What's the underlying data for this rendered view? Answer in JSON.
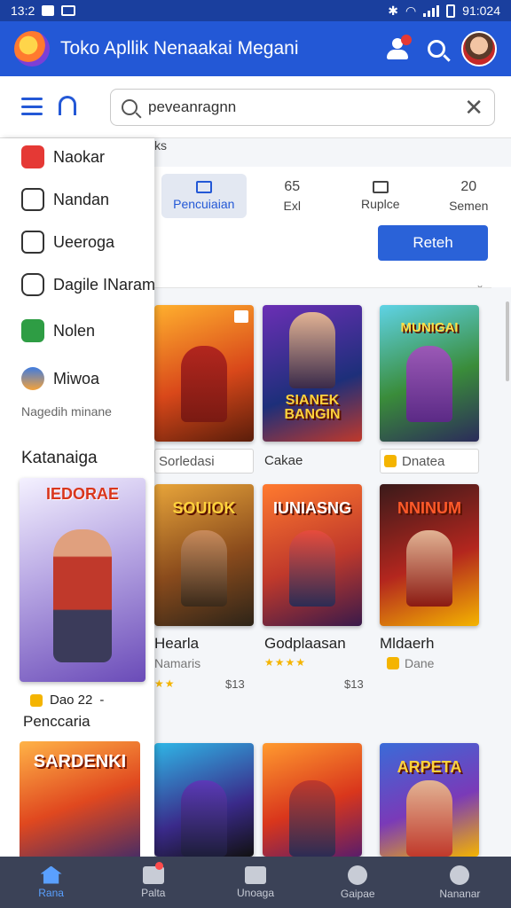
{
  "status_bar": {
    "time": "13:2",
    "right_time": "91:024"
  },
  "app": {
    "title": "Toko Apllik Nenaakai Megani"
  },
  "search": {
    "placeholder": "peveanragnn",
    "value": "peveanragnn"
  },
  "drawer": {
    "items": [
      {
        "label": "Naokar",
        "color": "#e53935"
      },
      {
        "label": "Nandan",
        "color": "#ffffff"
      },
      {
        "label": "Ueeroga",
        "color": "#ffffff"
      },
      {
        "label": "Dagile INarama",
        "color": "#ffffff"
      },
      {
        "label": "Nolen",
        "color": "#2e9d44"
      },
      {
        "label": "Miwoa",
        "color": "#3f7be0"
      }
    ],
    "sub_label": "Nagedih minane",
    "section_heading": "Katanaiga",
    "featured": {
      "title": "IEDORAE",
      "meta": "Dao 22",
      "meta_suffix": "-"
    },
    "footer_label": "Penccaria",
    "card2_title": "SARDENKI"
  },
  "content": {
    "breadcrumb": "ks",
    "tabs": [
      {
        "label": "Pencuiaian",
        "active": true,
        "num": ""
      },
      {
        "label": "Exl",
        "active": false,
        "num": "65"
      },
      {
        "label": "Ruplce",
        "active": false,
        "num": ""
      },
      {
        "label": "Semen",
        "active": false,
        "num": "20"
      }
    ],
    "refresh_label": "Reteh",
    "row1": {
      "titles": [
        "",
        "SIANEK BANGIN",
        "MUNIGAI"
      ],
      "labels": [
        "Sorledasi",
        "Cakae",
        "Dnatea"
      ]
    },
    "row2": {
      "titles": [
        "SOUIOK",
        "IUNIASNG",
        "NNINUM"
      ],
      "names": [
        "Hearla",
        "Godplaasan",
        "Mldaerh"
      ],
      "subs": [
        "Namaris",
        "",
        "Dane"
      ],
      "counts": [
        "$13",
        "$13",
        ""
      ]
    },
    "row3_title": "ARPETA"
  },
  "bottom_nav": [
    {
      "label": "Rana",
      "active": true
    },
    {
      "label": "Palta",
      "active": false
    },
    {
      "label": "Unoaga",
      "active": false
    },
    {
      "label": "Gaipae",
      "active": false
    },
    {
      "label": "Nananar",
      "active": false
    }
  ],
  "colors": {
    "primary": "#2358d6",
    "nav_bg": "#3b4257",
    "accent": "#2a62d8"
  }
}
